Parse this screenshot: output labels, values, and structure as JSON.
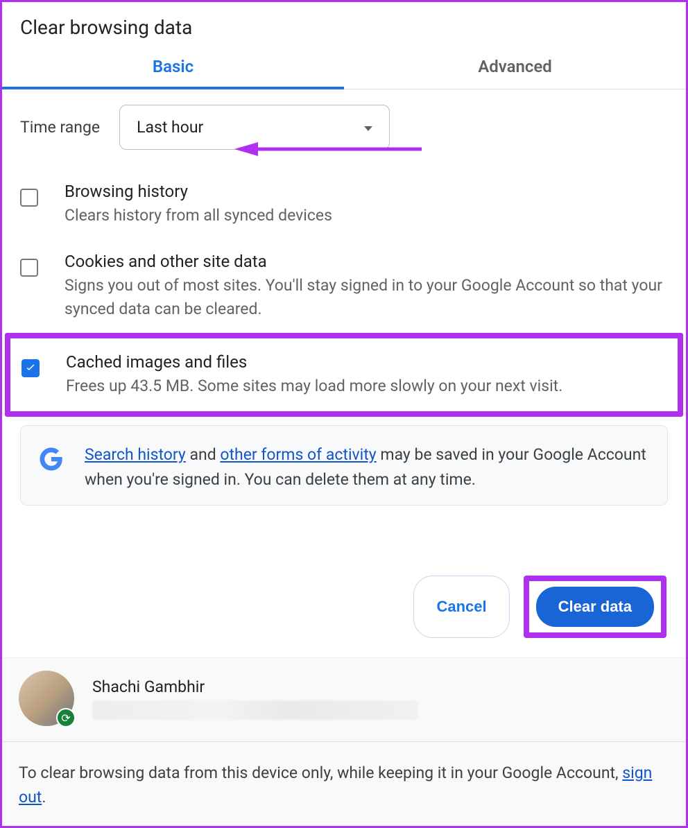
{
  "header": {
    "title": "Clear browsing data"
  },
  "tabs": {
    "basic": "Basic",
    "advanced": "Advanced"
  },
  "time_range": {
    "label": "Time range",
    "selected": "Last hour"
  },
  "items": [
    {
      "checked": false,
      "title": "Browsing history",
      "desc": "Clears history from all synced devices"
    },
    {
      "checked": false,
      "title": "Cookies and other site data",
      "desc": "Signs you out of most sites. You'll stay signed in to your Google Account so that your synced data can be cleared."
    },
    {
      "checked": true,
      "title": "Cached images and files",
      "desc": "Frees up 43.5 MB. Some sites may load more slowly on your next visit."
    }
  ],
  "infobox": {
    "link1": "Search history",
    "mid1": " and ",
    "link2": "other forms of activity",
    "rest": " may be saved in your Google Account when you're signed in. You can delete them at any time."
  },
  "actions": {
    "cancel": "Cancel",
    "clear": "Clear data"
  },
  "footer": {
    "user_name": "Shachi Gambhir",
    "text_pre": "To clear browsing data from this device only, while keeping it in your Google Account, ",
    "signout": "sign out",
    "text_post": "."
  }
}
